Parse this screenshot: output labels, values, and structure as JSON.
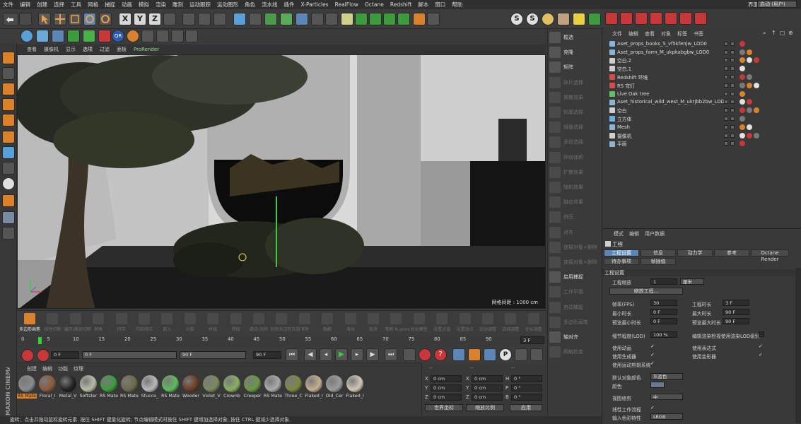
{
  "menubar": {
    "items": [
      "文件",
      "编辑",
      "创建",
      "选择",
      "工具",
      "网格",
      "捕捉",
      "动画",
      "模拟",
      "渲染",
      "雕刻",
      "运动跟踪",
      "运动图形",
      "角色",
      "流水线",
      "插件",
      "X-Particles",
      "RealFlow",
      "Octane",
      "Redshift",
      "脚本",
      "窗口",
      "帮助"
    ],
    "layout_label": "界面",
    "layout_value": "启动 (用户)"
  },
  "viewport": {
    "menu": [
      "查看",
      "摄像机",
      "显示",
      "选项",
      "过滤",
      "面板",
      "ProRender"
    ],
    "grid_label": "网格间距 : 1000 cm"
  },
  "right_palette": [
    {
      "label": "框选",
      "enabled": true
    },
    {
      "label": "克隆",
      "enabled": true
    },
    {
      "label": "矩阵",
      "enabled": true
    },
    {
      "label": "碎片选择",
      "enabled": false
    },
    {
      "label": "推散效果",
      "enabled": false
    },
    {
      "label": "轮廓选择",
      "enabled": false
    },
    {
      "label": "镜像选择",
      "enabled": false
    },
    {
      "label": "多段选择",
      "enabled": false
    },
    {
      "label": "环绕体积",
      "enabled": false
    },
    {
      "label": "扩散效果",
      "enabled": false
    },
    {
      "label": "随机效果",
      "enabled": false
    },
    {
      "label": "融合效果",
      "enabled": false
    },
    {
      "label": "挤压",
      "enabled": false
    },
    {
      "label": "对齐",
      "enabled": false
    },
    {
      "label": "连接对象+删除",
      "enabled": false
    },
    {
      "label": "连接对象+删除",
      "enabled": false
    },
    {
      "label": "启用捕捉",
      "enabled": true
    },
    {
      "label": "工作平面",
      "enabled": false
    },
    {
      "label": "启动捕捉",
      "enabled": false
    },
    {
      "label": "多边形画笔",
      "enabled": false
    },
    {
      "label": "轴对齐",
      "enabled": true
    },
    {
      "label": "网格检查",
      "enabled": false
    }
  ],
  "object_manager": {
    "menu": [
      "文件",
      "编辑",
      "查看",
      "对象",
      "标签",
      "书签"
    ],
    "objects": [
      {
        "name": "Aset_props_books_S_vf5kfenjw_LOD0",
        "icon": "null-icon",
        "color": "#8ab4d8"
      },
      {
        "name": "Aset_props_farm_M_ukpkabgbw_LOD0",
        "icon": "null-icon",
        "color": "#8ab4d8"
      },
      {
        "name": "空白.2",
        "icon": "group-icon",
        "color": "#cfcfcf"
      },
      {
        "name": "空白.1",
        "icon": "group-icon",
        "color": "#cfcfcf"
      },
      {
        "name": "Redshift 环境",
        "icon": "environment-icon",
        "color": "#d84a4a"
      },
      {
        "name": "RS 穹灯",
        "icon": "light-icon",
        "color": "#d84a4a"
      },
      {
        "name": "Live Oak tree",
        "icon": "tree-icon",
        "color": "#5fc45f"
      },
      {
        "name": "Aset_historical_wild_west_M_ukrjbb2bw_LOD0",
        "icon": "null-icon",
        "color": "#8ab4d8"
      },
      {
        "name": "空白",
        "icon": "group-icon",
        "color": "#cfcfcf"
      },
      {
        "name": "立方体",
        "icon": "cube-icon",
        "color": "#6ab0e0"
      },
      {
        "name": "Mesh",
        "icon": "mesh-icon",
        "color": "#8ab4d8"
      },
      {
        "name": "摄像机",
        "icon": "camera-icon",
        "color": "#cfcfcf"
      },
      {
        "name": "平面",
        "icon": "plane-icon",
        "color": "#8ab4d8"
      }
    ]
  },
  "attribute_manager": {
    "menu": [
      "模式",
      "编辑",
      "用户数据"
    ],
    "title": "工程",
    "tabs_row1": [
      "工程设置",
      "信息",
      "动力学",
      "参考",
      "Octane Render"
    ],
    "tabs_row2": [
      "待办事项",
      "帧插值"
    ],
    "section": "工程设置",
    "project_scale_label": "工程缩放",
    "project_scale_value": "1",
    "project_scale_unit": "厘米",
    "scale_button": "缩放工程...",
    "fps_label": "帧率(FPS)",
    "fps_value": "30",
    "project_time_label": "工程时长",
    "project_time_value": "3 F",
    "min_time_label": "最小时长",
    "min_time_value": "0 F",
    "max_time_label": "最大时长",
    "max_time_value": "90 F",
    "preview_min_label": "预览最小时长",
    "preview_min_value": "0 F",
    "preview_max_label": "预览最大时长",
    "preview_max_value": "90 F",
    "lod_label": "细节程度(LOD)",
    "lod_value": "100 %",
    "lod_render_label": "编辑渲染检视使用渲染LOD级别",
    "use_anim_label": "使用动画",
    "use_expr_label": "使用表达式",
    "use_gen_label": "使用生成器",
    "use_deform_label": "使用变形器",
    "use_motion_label": "使用运动剪辑系统",
    "default_color_label": "默认对象颜色",
    "default_color_value": "灰蓝色",
    "color_label": "颜色",
    "view_clip_label": "视图修剪",
    "view_clip_value": "中",
    "linear_workflow_label": "线性工作流程",
    "input_color_label": "输入色彩特性",
    "input_color_value": "sRGB"
  },
  "generator_bar": [
    {
      "label": "多边形画笔",
      "on": true
    },
    {
      "label": "线性切割",
      "on": false
    },
    {
      "label": "循环/路径切割",
      "on": false
    },
    {
      "label": "倒角",
      "on": false
    },
    {
      "label": "挤压",
      "on": false
    },
    {
      "label": "内部挤压",
      "on": false
    },
    {
      "label": "嵌入",
      "on": false
    },
    {
      "label": "分裂",
      "on": false
    },
    {
      "label": "桥接",
      "on": false
    },
    {
      "label": "焊接",
      "on": false
    },
    {
      "label": "缝合/消除",
      "on": false
    },
    {
      "label": "封闭多边形孔洞",
      "on": false
    },
    {
      "label": "消除",
      "on": false
    },
    {
      "label": "融解",
      "on": false
    },
    {
      "label": "滑动",
      "on": false
    },
    {
      "label": "熨烫",
      "on": false
    },
    {
      "label": "笔刷 N-gons",
      "on": false
    },
    {
      "label": "优化模型",
      "on": false
    },
    {
      "label": "设置点值",
      "on": false
    },
    {
      "label": "设置顶点",
      "on": false
    },
    {
      "label": "运动调整",
      "on": false
    },
    {
      "label": "选择调整",
      "on": false
    },
    {
      "label": "坐标调整",
      "on": false
    }
  ],
  "timeline": {
    "ticks": [
      "0",
      "5",
      "10",
      "15",
      "20",
      "25",
      "30",
      "35",
      "40",
      "45",
      "50",
      "55",
      "60",
      "65",
      "70",
      "75",
      "80",
      "85",
      "90"
    ],
    "current_frame_value": "3 F",
    "start_value": "0 F",
    "preview_start": "0 F",
    "preview_end": "90 F",
    "end_value": "90 F"
  },
  "material_manager": {
    "menu": [
      "创建",
      "编辑",
      "功能",
      "纹理"
    ],
    "materials": [
      {
        "name": "RS Mate",
        "color": "#8a8a8a",
        "selected": true
      },
      {
        "name": "Floral_I",
        "color": "#8b5a3c",
        "selected": false
      },
      {
        "name": "Metal_V",
        "color": "#222222",
        "selected": false
      },
      {
        "name": "Softster",
        "color": "#b9b9a8",
        "selected": false
      },
      {
        "name": "RS Mate",
        "color": "#3c9c3c",
        "selected": false
      },
      {
        "name": "RS Mate",
        "color": "#6b6b4a",
        "selected": false
      },
      {
        "name": "Stucco_",
        "color": "#b8b8b8",
        "selected": false
      },
      {
        "name": "RS Mate",
        "color": "#5cbc5c",
        "selected": false
      },
      {
        "name": "Wooder",
        "color": "#6a3c24",
        "selected": false
      },
      {
        "name": "Violet_V",
        "color": "#7a8a5a",
        "selected": false
      },
      {
        "name": "Crownb",
        "color": "#8ab060",
        "selected": false
      },
      {
        "name": "Creeper",
        "color": "#6a9a40",
        "selected": false
      },
      {
        "name": "RS Mate",
        "color": "#aaaaaa",
        "selected": false
      },
      {
        "name": "Three_C",
        "color": "#7a8a40",
        "selected": false
      },
      {
        "name": "Flaked_I",
        "color": "#c4b090",
        "selected": false
      },
      {
        "name": "Old_Cer",
        "color": "#9c9c9c",
        "selected": false
      },
      {
        "name": "Flaked_I",
        "color": "#d0c8b4",
        "selected": false
      }
    ]
  },
  "coordinates": {
    "headers": [
      "--",
      "--",
      "--"
    ],
    "rows": [
      {
        "axis1": "X",
        "val1": "0 cm",
        "axis2": "X",
        "val2": "0 cm",
        "axis3": "H",
        "val3": "0 °"
      },
      {
        "axis1": "Y",
        "val1": "0 cm",
        "axis2": "Y",
        "val2": "0 cm",
        "axis3": "P",
        "val3": "0 °"
      },
      {
        "axis1": "Z",
        "val1": "0 cm",
        "axis2": "Z",
        "val2": "0 cm",
        "axis3": "B",
        "val3": "0 °"
      }
    ],
    "mode1": "世界坐标",
    "mode2": "缩放比例",
    "apply": "应用"
  },
  "status_text": "旋转：点击并拖动鼠标旋转元素. 按住 SHIFT 键量化旋转; 节点编辑模式时按住 SHIFT 键增加选择对象; 按住 CTRL 键减少选择对象.",
  "maxon_logo": "MAXON CINEMA 4D",
  "colors": {
    "accent_blue": "#5a87b8",
    "accent_orange": "#d9822b",
    "axis_green": "#34d234"
  }
}
